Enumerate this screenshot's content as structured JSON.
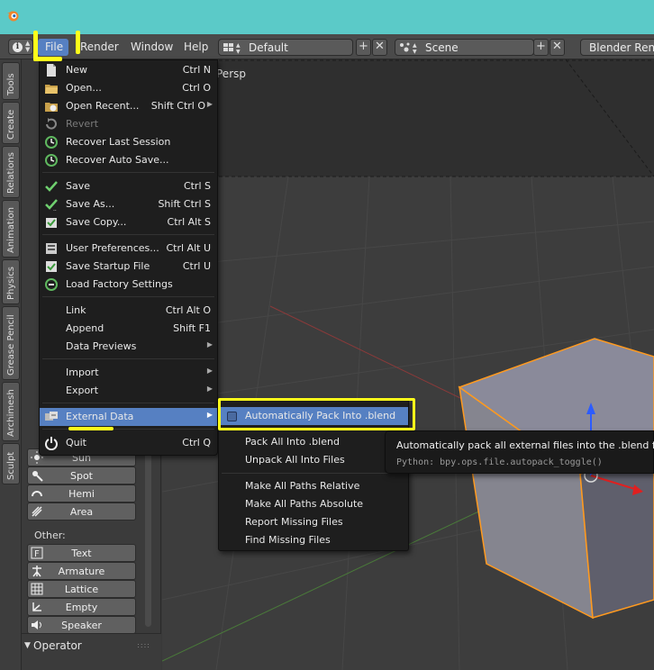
{
  "colors": {
    "accent": "#5680c2",
    "titlebar": "#5bcac8",
    "annotation": "#ffff1a",
    "selection": "#ff9a1f"
  },
  "titlebar": {
    "icon": "blender-logo-icon"
  },
  "header": {
    "info_icon": "info-icon",
    "menus": [
      "File",
      "Render",
      "Window",
      "Help"
    ],
    "screen_layout": "Default",
    "scene": "Scene",
    "render_engine": "Blender Render"
  },
  "tool_tabs": [
    "Tools",
    "Create",
    "Relations",
    "Animation",
    "Physics",
    "Grease Pencil",
    "Archimesh",
    "Sculpt"
  ],
  "toolshelf": {
    "other_heading": "Other:",
    "lamp_items": [
      "Sun",
      "Spot",
      "Hemi",
      "Area"
    ],
    "other_items": [
      "Text",
      "Armature",
      "Lattice",
      "Empty",
      "Speaker"
    ],
    "operator_panel": "Operator"
  },
  "viewport": {
    "label": "Persp"
  },
  "file_menu": {
    "items": [
      {
        "label": "New",
        "shortcut": "Ctrl N",
        "icon": "new-file-icon"
      },
      {
        "label": "Open...",
        "shortcut": "Ctrl O",
        "icon": "open-folder-icon"
      },
      {
        "label": "Open Recent...",
        "shortcut": "Shift Ctrl O",
        "icon": "open-recent-icon"
      },
      {
        "label": "Revert",
        "shortcut": "",
        "icon": "revert-icon"
      },
      {
        "label": "Recover Last Session",
        "shortcut": "",
        "icon": "recover-icon"
      },
      {
        "label": "Recover Auto Save...",
        "shortcut": "",
        "icon": "recover-auto-icon"
      },
      {
        "label": "Save",
        "shortcut": "Ctrl S",
        "icon": "save-check-icon"
      },
      {
        "label": "Save As...",
        "shortcut": "Shift Ctrl S",
        "icon": "save-as-icon"
      },
      {
        "label": "Save Copy...",
        "shortcut": "Ctrl Alt S",
        "icon": "save-copy-icon"
      },
      {
        "label": "User Preferences...",
        "shortcut": "Ctrl Alt U",
        "icon": "preferences-icon"
      },
      {
        "label": "Save Startup File",
        "shortcut": "Ctrl U",
        "icon": "save-startup-icon"
      },
      {
        "label": "Load Factory Settings",
        "shortcut": "",
        "icon": "load-factory-icon"
      },
      {
        "label": "Link",
        "shortcut": "Ctrl Alt O",
        "icon": "link-icon"
      },
      {
        "label": "Append",
        "shortcut": "Shift F1",
        "icon": "append-icon"
      },
      {
        "label": "Data Previews",
        "shortcut": "",
        "icon": ""
      },
      {
        "label": "Import",
        "shortcut": "",
        "icon": ""
      },
      {
        "label": "Export",
        "shortcut": "",
        "icon": ""
      },
      {
        "label": "External Data",
        "shortcut": "",
        "icon": "external-data-icon"
      },
      {
        "label": "Quit",
        "shortcut": "Ctrl Q",
        "icon": "quit-icon"
      }
    ]
  },
  "external_data_menu": {
    "items": [
      "Automatically Pack Into .blend",
      "Pack All Into .blend",
      "Unpack All Into Files",
      "Make All Paths Relative",
      "Make All Paths Absolute",
      "Report Missing Files",
      "Find Missing Files"
    ],
    "autopack_checked": false
  },
  "tooltip": {
    "description": "Automatically pack all external files into the .blend file",
    "python": "Python: bpy.ops.file.autopack_toggle()"
  }
}
